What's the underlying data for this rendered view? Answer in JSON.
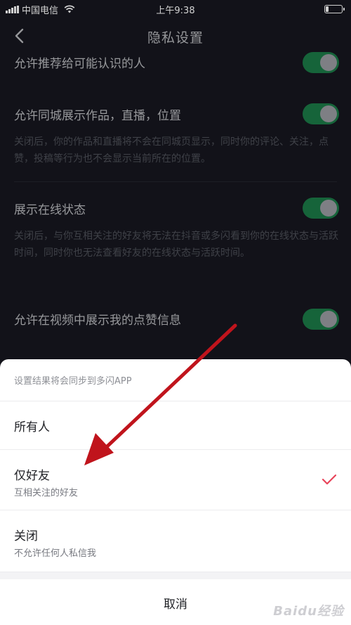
{
  "status_bar": {
    "carrier": "中国电信",
    "time": "上午9:38",
    "battery_level": 0.2
  },
  "header": {
    "title": "隐私设置",
    "back_icon": "chevron-left-icon"
  },
  "settings": [
    {
      "label": "允许推荐给可能认识的人",
      "enabled": true
    },
    {
      "label": "允许同城展示作品，直播，位置",
      "enabled": true,
      "description": "关闭后，你的作品和直播将不会在同城页显示，同时你的评论、关注，点赞，投稿等行为也不会显示当前所在的位置。"
    },
    {
      "label": "展示在线状态",
      "enabled": true,
      "description": "关闭后，与你互相关注的好友将无法在抖音或多闪看到你的在线状态与活跃时间，同时你也无法查看好友的在线状态与活跃时间。"
    },
    {
      "label": "允许在视频中展示我的点赞信息",
      "enabled": true
    }
  ],
  "sheet": {
    "header": "设置结果将会同步到多闪APP",
    "options": [
      {
        "title": "所有人",
        "subtitle": "",
        "selected": false
      },
      {
        "title": "仅好友",
        "subtitle": "互相关注的好友",
        "selected": true
      },
      {
        "title": "关闭",
        "subtitle": "不允许任何人私信我",
        "selected": false
      }
    ],
    "cancel_label": "取消"
  },
  "watermark": "Baidu经验",
  "colors": {
    "background": "#16171f",
    "toggle_on": "#1c7a47",
    "check": "#e8445a",
    "arrow": "#c0141c"
  }
}
